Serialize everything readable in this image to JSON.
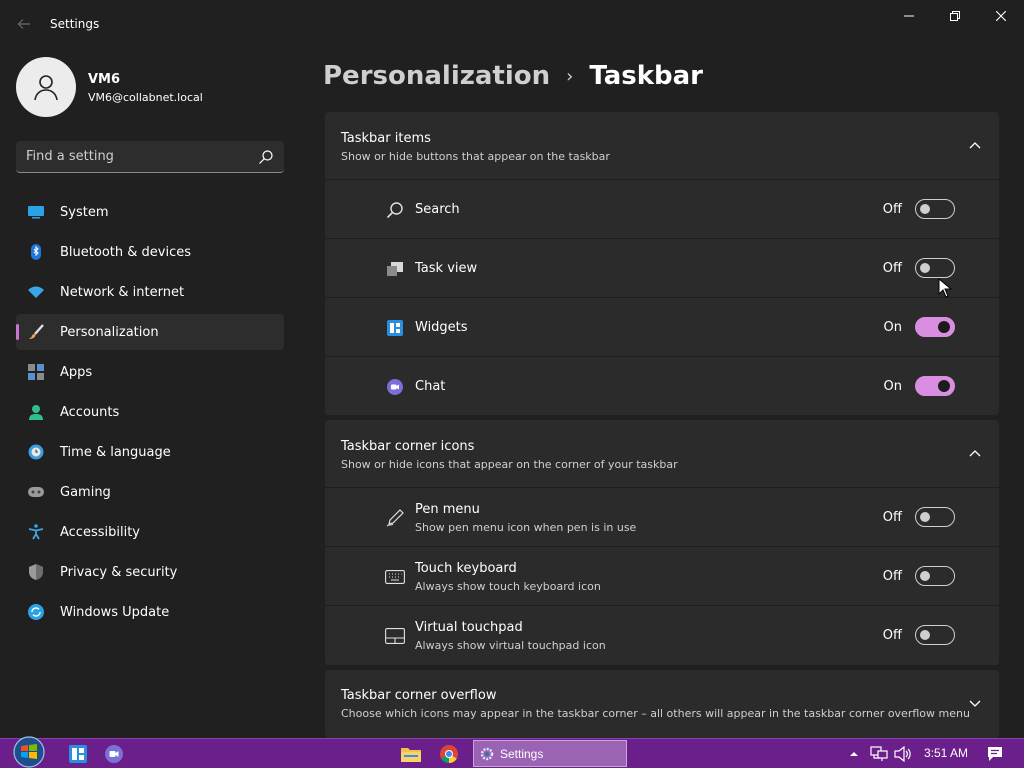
{
  "window": {
    "title": "Settings"
  },
  "profile": {
    "name": "VM6",
    "email": "VM6@collabnet.local"
  },
  "search": {
    "placeholder": "Find a setting"
  },
  "sidebar": {
    "items": [
      {
        "label": "System",
        "icon": "system-icon"
      },
      {
        "label": "Bluetooth & devices",
        "icon": "bluetooth-icon"
      },
      {
        "label": "Network & internet",
        "icon": "wifi-icon"
      },
      {
        "label": "Personalization",
        "icon": "brush-icon",
        "active": true
      },
      {
        "label": "Apps",
        "icon": "apps-icon"
      },
      {
        "label": "Accounts",
        "icon": "accounts-icon"
      },
      {
        "label": "Time & language",
        "icon": "clock-icon"
      },
      {
        "label": "Gaming",
        "icon": "gamepad-icon"
      },
      {
        "label": "Accessibility",
        "icon": "accessibility-icon"
      },
      {
        "label": "Privacy & security",
        "icon": "shield-icon"
      },
      {
        "label": "Windows Update",
        "icon": "update-icon"
      }
    ]
  },
  "breadcrumb": {
    "parent": "Personalization",
    "separator": "›",
    "current": "Taskbar"
  },
  "sections": {
    "taskbar_items": {
      "title": "Taskbar items",
      "subtitle": "Show or hide buttons that appear on the taskbar",
      "rows": [
        {
          "label": "Search",
          "state": "Off",
          "on": false
        },
        {
          "label": "Task view",
          "state": "Off",
          "on": false
        },
        {
          "label": "Widgets",
          "state": "On",
          "on": true
        },
        {
          "label": "Chat",
          "state": "On",
          "on": true
        }
      ]
    },
    "corner_icons": {
      "title": "Taskbar corner icons",
      "subtitle": "Show or hide icons that appear on the corner of your taskbar",
      "rows": [
        {
          "label": "Pen menu",
          "description": "Show pen menu icon when pen is in use",
          "state": "Off",
          "on": false
        },
        {
          "label": "Touch keyboard",
          "description": "Always show touch keyboard icon",
          "state": "Off",
          "on": false
        },
        {
          "label": "Virtual touchpad",
          "description": "Always show virtual touchpad icon",
          "state": "Off",
          "on": false
        }
      ]
    },
    "corner_overflow": {
      "title": "Taskbar corner overflow",
      "subtitle": "Choose which icons may appear in the taskbar corner – all others will appear in the taskbar corner overflow menu"
    }
  },
  "taskbar": {
    "task_label": "Settings",
    "time": "3:51 AM"
  },
  "colors": {
    "accent": "#d98ee2",
    "taskbar": "#6b1f8a",
    "background": "#202020",
    "card": "#2b2b2b"
  }
}
